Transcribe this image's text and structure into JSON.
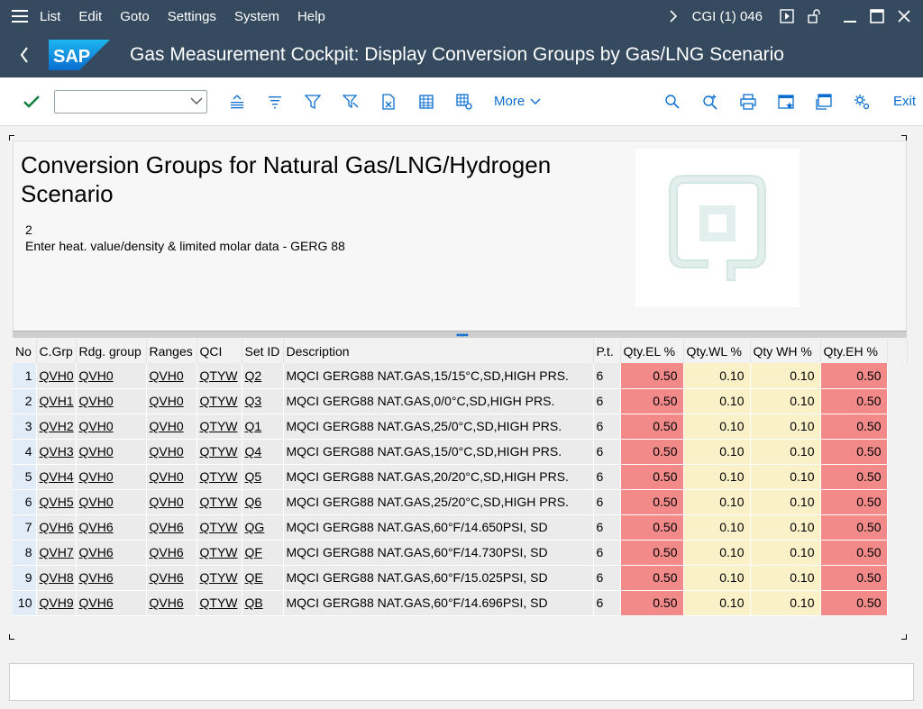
{
  "menu": {
    "items": [
      "List",
      "Edit",
      "Goto",
      "Settings",
      "System",
      "Help"
    ],
    "system_info": "CGI (1) 046"
  },
  "header": {
    "title": "Gas Measurement Cockpit: Display Conversion Groups by Gas/LNG Scenario",
    "logo_text": "SAP"
  },
  "toolbar": {
    "more_label": "More",
    "exit_label": "Exit",
    "command_value": ""
  },
  "panel": {
    "title": "Conversion Groups for Natural Gas/LNG/Hydrogen Scenario",
    "number": "2",
    "description": "Enter heat. value/density & limited molar data - GERG 88"
  },
  "table": {
    "columns": [
      "No",
      "C.Grp",
      "Rdg. group",
      "Ranges",
      "QCI",
      "Set ID",
      "Description",
      "P.t.",
      "Qty.EL %",
      "Qty.WL %",
      "Qty WH %",
      "Qty.EH %"
    ],
    "rows": [
      [
        "1",
        "QVH0",
        "QVH0",
        "QVH0",
        "QTYW",
        "Q2",
        "MQCI GERG88 NAT.GAS,15/15°C,SD,HIGH PRS.",
        "6",
        "0.50",
        "0.10",
        "0.10",
        "0.50"
      ],
      [
        "2",
        "QVH1",
        "QVH0",
        "QVH0",
        "QTYW",
        "Q3",
        "MQCI GERG88 NAT.GAS,0/0°C,SD,HIGH PRS.",
        "6",
        "0.50",
        "0.10",
        "0.10",
        "0.50"
      ],
      [
        "3",
        "QVH2",
        "QVH0",
        "QVH0",
        "QTYW",
        "Q1",
        "MQCI GERG88 NAT.GAS,25/0°C,SD,HIGH PRS.",
        "6",
        "0.50",
        "0.10",
        "0.10",
        "0.50"
      ],
      [
        "4",
        "QVH3",
        "QVH0",
        "QVH0",
        "QTYW",
        "Q4",
        "MQCI GERG88 NAT.GAS,15/0°C,SD,HIGH PRS.",
        "6",
        "0.50",
        "0.10",
        "0.10",
        "0.50"
      ],
      [
        "5",
        "QVH4",
        "QVH0",
        "QVH0",
        "QTYW",
        "Q5",
        "MQCI GERG88 NAT.GAS,20/20°C,SD,HIGH PRS.",
        "6",
        "0.50",
        "0.10",
        "0.10",
        "0.50"
      ],
      [
        "6",
        "QVH5",
        "QVH0",
        "QVH0",
        "QTYW",
        "Q6",
        "MQCI GERG88 NAT.GAS,25/20°C,SD,HIGH PRS.",
        "6",
        "0.50",
        "0.10",
        "0.10",
        "0.50"
      ],
      [
        "7",
        "QVH6",
        "QVH6",
        "QVH6",
        "QTYW",
        "QG",
        "MQCI GERG88 NAT.GAS,60°F/14.650PSI, SD",
        "6",
        "0.50",
        "0.10",
        "0.10",
        "0.50"
      ],
      [
        "8",
        "QVH7",
        "QVH6",
        "QVH6",
        "QTYW",
        "QF",
        "MQCI GERG88 NAT.GAS,60°F/14.730PSI, SD",
        "6",
        "0.50",
        "0.10",
        "0.10",
        "0.50"
      ],
      [
        "9",
        "QVH8",
        "QVH6",
        "QVH6",
        "QTYW",
        "QE",
        "MQCI GERG88 NAT.GAS,60°F/15.025PSI, SD",
        "6",
        "0.50",
        "0.10",
        "0.10",
        "0.50"
      ],
      [
        "10",
        "QVH9",
        "QVH6",
        "QVH6",
        "QTYW",
        "QB",
        "MQCI GERG88 NAT.GAS,60°F/14.696PSI, SD",
        "6",
        "0.50",
        "0.10",
        "0.10",
        "0.50"
      ]
    ]
  },
  "colors": {
    "shell": "#354a5f",
    "accent": "#0a6ed1",
    "error_cell": "#f28a8a",
    "warning_cell": "#faf1c9",
    "confirm": "#107e3e"
  },
  "icons": {
    "toolbar": [
      "sort-ascending-icon",
      "sort-descending-icon",
      "filter-icon",
      "set-filter-icon",
      "export-excel-icon",
      "table-layout-icon",
      "table-settings-icon"
    ],
    "toolbar_right": [
      "search-icon",
      "search-next-icon",
      "print-icon",
      "add-favorite-icon",
      "new-window-icon",
      "settings-icon"
    ]
  }
}
